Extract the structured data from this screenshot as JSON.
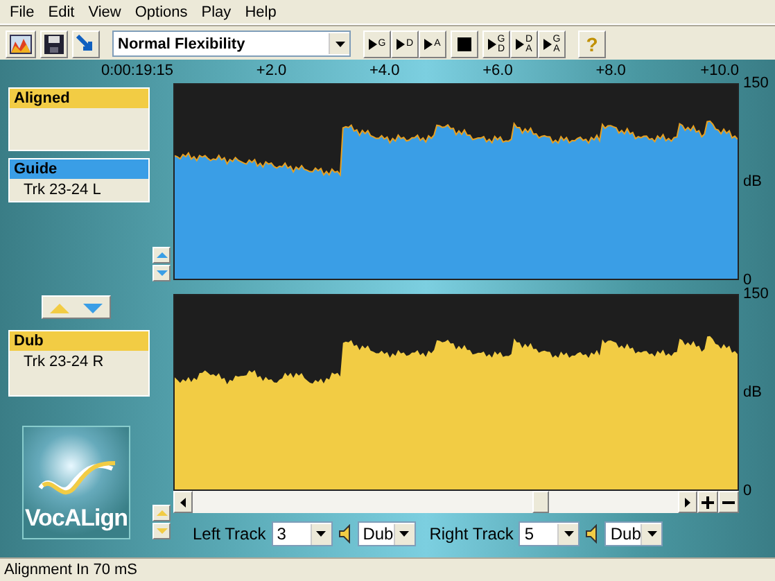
{
  "menu": [
    "File",
    "Edit",
    "View",
    "Options",
    "Play",
    "Help"
  ],
  "toolbar": {
    "preset": "Normal Flexibility",
    "play_buttons": [
      {
        "letters": [
          "G"
        ]
      },
      {
        "letters": [
          "D"
        ]
      },
      {
        "letters": [
          "A"
        ]
      }
    ],
    "combo_play_buttons": [
      {
        "letters": [
          "G",
          "D"
        ]
      },
      {
        "letters": [
          "D",
          "A"
        ]
      },
      {
        "letters": [
          "G",
          "A"
        ]
      }
    ],
    "help": "?"
  },
  "ruler": {
    "labels": [
      "0:00:19:15",
      "+2.0",
      "+4.0",
      "+6.0",
      "+8.0",
      "+10.0"
    ]
  },
  "tracks": [
    {
      "title": "Aligned",
      "color": "#f2cc44"
    },
    {
      "title": "Guide",
      "color": "#3a9ee6",
      "items": [
        "Trk 23-24 L"
      ]
    },
    {
      "title": "Dub",
      "color": "#f2cc44",
      "items": [
        "Trk 23-24 R"
      ]
    }
  ],
  "waveforms": [
    {
      "color": "#3a9ee6",
      "scale": [
        "150",
        "dB",
        "0"
      ]
    },
    {
      "color": "#f2cc44",
      "scale": [
        "150",
        "dB",
        "0"
      ]
    }
  ],
  "logo": {
    "text": "VocALign"
  },
  "track_controls": [
    {
      "label": "Left Track",
      "track": "3",
      "mode": "Dub"
    },
    {
      "label": "Right Track",
      "track": "5",
      "mode": "Dub"
    }
  ],
  "status_bar": "Alignment In 70 mS"
}
